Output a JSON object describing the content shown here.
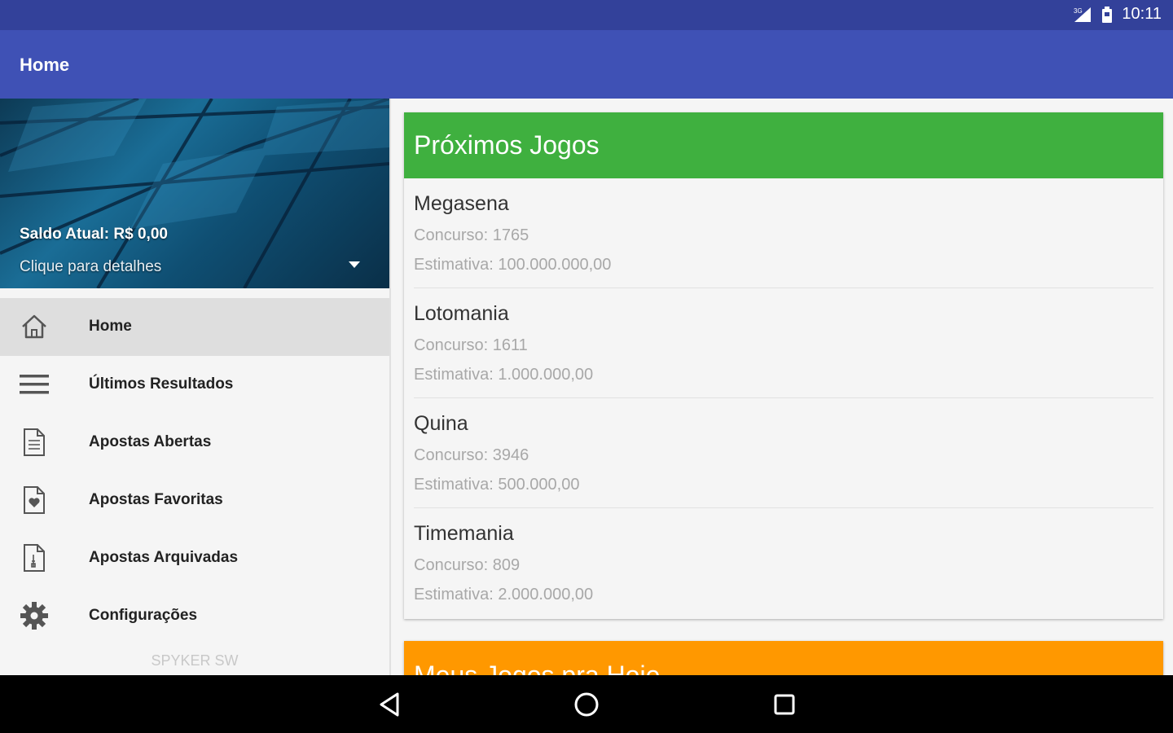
{
  "status_bar": {
    "time": "10:11",
    "icons": [
      "signal-icon",
      "battery-icon"
    ]
  },
  "app_bar": {
    "title": "Home"
  },
  "drawer": {
    "header": {
      "saldo": "Saldo Atual: R$ 0,00",
      "detalhes": "Clique para detalhes"
    },
    "items": [
      {
        "label": "Home",
        "icon": "home-icon",
        "active": true
      },
      {
        "label": "Últimos Resultados",
        "icon": "list-icon",
        "active": false
      },
      {
        "label": "Apostas Abertas",
        "icon": "document-icon",
        "active": false
      },
      {
        "label": "Apostas Favoritas",
        "icon": "favorite-document-icon",
        "active": false
      },
      {
        "label": "Apostas Arquivadas",
        "icon": "archive-document-icon",
        "active": false
      },
      {
        "label": "Configurações",
        "icon": "gear-icon",
        "active": false
      }
    ],
    "footer": "SPYKER SW"
  },
  "main": {
    "proximos": {
      "title": "Próximos Jogos",
      "games": [
        {
          "name": "Megasena",
          "concurso": "Concurso: 1765",
          "estimativa": "Estimativa: 100.000.000,00"
        },
        {
          "name": "Lotomania",
          "concurso": "Concurso: 1611",
          "estimativa": "Estimativa: 1.000.000,00"
        },
        {
          "name": "Quina",
          "concurso": "Concurso: 3946",
          "estimativa": "Estimativa: 500.000,00"
        },
        {
          "name": "Timemania",
          "concurso": "Concurso: 809",
          "estimativa": "Estimativa: 2.000.000,00"
        }
      ]
    },
    "meus_jogos": {
      "title": "Meus Jogos pra Hoje"
    }
  },
  "colors": {
    "status_bar": "#33419a",
    "app_bar": "#3f51b5",
    "proximos_header": "#3fb03f",
    "meus_jogos_header": "#ff9800"
  }
}
